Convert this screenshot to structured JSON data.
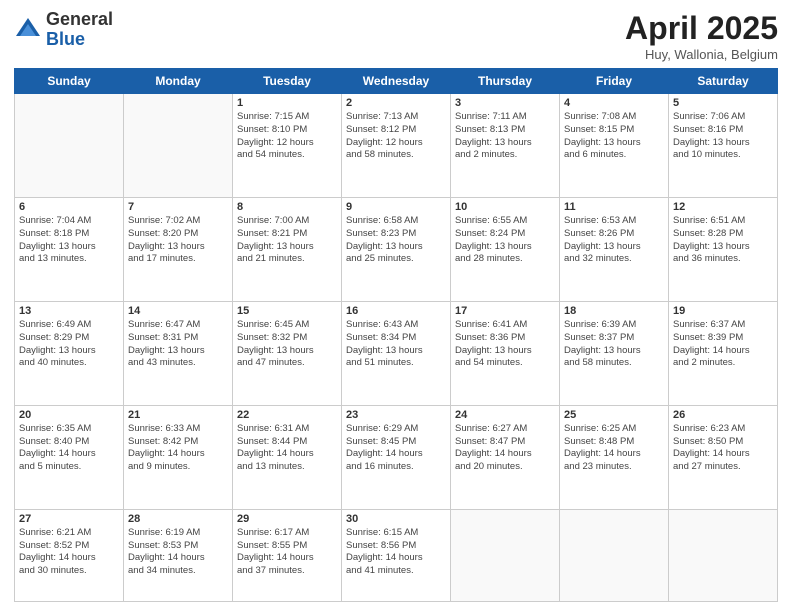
{
  "header": {
    "logo_general": "General",
    "logo_blue": "Blue",
    "title": "April 2025",
    "subtitle": "Huy, Wallonia, Belgium"
  },
  "days_of_week": [
    "Sunday",
    "Monday",
    "Tuesday",
    "Wednesday",
    "Thursday",
    "Friday",
    "Saturday"
  ],
  "weeks": [
    [
      {
        "day": "",
        "info": ""
      },
      {
        "day": "",
        "info": ""
      },
      {
        "day": "1",
        "info": "Sunrise: 7:15 AM\nSunset: 8:10 PM\nDaylight: 12 hours\nand 54 minutes."
      },
      {
        "day": "2",
        "info": "Sunrise: 7:13 AM\nSunset: 8:12 PM\nDaylight: 12 hours\nand 58 minutes."
      },
      {
        "day": "3",
        "info": "Sunrise: 7:11 AM\nSunset: 8:13 PM\nDaylight: 13 hours\nand 2 minutes."
      },
      {
        "day": "4",
        "info": "Sunrise: 7:08 AM\nSunset: 8:15 PM\nDaylight: 13 hours\nand 6 minutes."
      },
      {
        "day": "5",
        "info": "Sunrise: 7:06 AM\nSunset: 8:16 PM\nDaylight: 13 hours\nand 10 minutes."
      }
    ],
    [
      {
        "day": "6",
        "info": "Sunrise: 7:04 AM\nSunset: 8:18 PM\nDaylight: 13 hours\nand 13 minutes."
      },
      {
        "day": "7",
        "info": "Sunrise: 7:02 AM\nSunset: 8:20 PM\nDaylight: 13 hours\nand 17 minutes."
      },
      {
        "day": "8",
        "info": "Sunrise: 7:00 AM\nSunset: 8:21 PM\nDaylight: 13 hours\nand 21 minutes."
      },
      {
        "day": "9",
        "info": "Sunrise: 6:58 AM\nSunset: 8:23 PM\nDaylight: 13 hours\nand 25 minutes."
      },
      {
        "day": "10",
        "info": "Sunrise: 6:55 AM\nSunset: 8:24 PM\nDaylight: 13 hours\nand 28 minutes."
      },
      {
        "day": "11",
        "info": "Sunrise: 6:53 AM\nSunset: 8:26 PM\nDaylight: 13 hours\nand 32 minutes."
      },
      {
        "day": "12",
        "info": "Sunrise: 6:51 AM\nSunset: 8:28 PM\nDaylight: 13 hours\nand 36 minutes."
      }
    ],
    [
      {
        "day": "13",
        "info": "Sunrise: 6:49 AM\nSunset: 8:29 PM\nDaylight: 13 hours\nand 40 minutes."
      },
      {
        "day": "14",
        "info": "Sunrise: 6:47 AM\nSunset: 8:31 PM\nDaylight: 13 hours\nand 43 minutes."
      },
      {
        "day": "15",
        "info": "Sunrise: 6:45 AM\nSunset: 8:32 PM\nDaylight: 13 hours\nand 47 minutes."
      },
      {
        "day": "16",
        "info": "Sunrise: 6:43 AM\nSunset: 8:34 PM\nDaylight: 13 hours\nand 51 minutes."
      },
      {
        "day": "17",
        "info": "Sunrise: 6:41 AM\nSunset: 8:36 PM\nDaylight: 13 hours\nand 54 minutes."
      },
      {
        "day": "18",
        "info": "Sunrise: 6:39 AM\nSunset: 8:37 PM\nDaylight: 13 hours\nand 58 minutes."
      },
      {
        "day": "19",
        "info": "Sunrise: 6:37 AM\nSunset: 8:39 PM\nDaylight: 14 hours\nand 2 minutes."
      }
    ],
    [
      {
        "day": "20",
        "info": "Sunrise: 6:35 AM\nSunset: 8:40 PM\nDaylight: 14 hours\nand 5 minutes."
      },
      {
        "day": "21",
        "info": "Sunrise: 6:33 AM\nSunset: 8:42 PM\nDaylight: 14 hours\nand 9 minutes."
      },
      {
        "day": "22",
        "info": "Sunrise: 6:31 AM\nSunset: 8:44 PM\nDaylight: 14 hours\nand 13 minutes."
      },
      {
        "day": "23",
        "info": "Sunrise: 6:29 AM\nSunset: 8:45 PM\nDaylight: 14 hours\nand 16 minutes."
      },
      {
        "day": "24",
        "info": "Sunrise: 6:27 AM\nSunset: 8:47 PM\nDaylight: 14 hours\nand 20 minutes."
      },
      {
        "day": "25",
        "info": "Sunrise: 6:25 AM\nSunset: 8:48 PM\nDaylight: 14 hours\nand 23 minutes."
      },
      {
        "day": "26",
        "info": "Sunrise: 6:23 AM\nSunset: 8:50 PM\nDaylight: 14 hours\nand 27 minutes."
      }
    ],
    [
      {
        "day": "27",
        "info": "Sunrise: 6:21 AM\nSunset: 8:52 PM\nDaylight: 14 hours\nand 30 minutes."
      },
      {
        "day": "28",
        "info": "Sunrise: 6:19 AM\nSunset: 8:53 PM\nDaylight: 14 hours\nand 34 minutes."
      },
      {
        "day": "29",
        "info": "Sunrise: 6:17 AM\nSunset: 8:55 PM\nDaylight: 14 hours\nand 37 minutes."
      },
      {
        "day": "30",
        "info": "Sunrise: 6:15 AM\nSunset: 8:56 PM\nDaylight: 14 hours\nand 41 minutes."
      },
      {
        "day": "",
        "info": ""
      },
      {
        "day": "",
        "info": ""
      },
      {
        "day": "",
        "info": ""
      }
    ]
  ]
}
